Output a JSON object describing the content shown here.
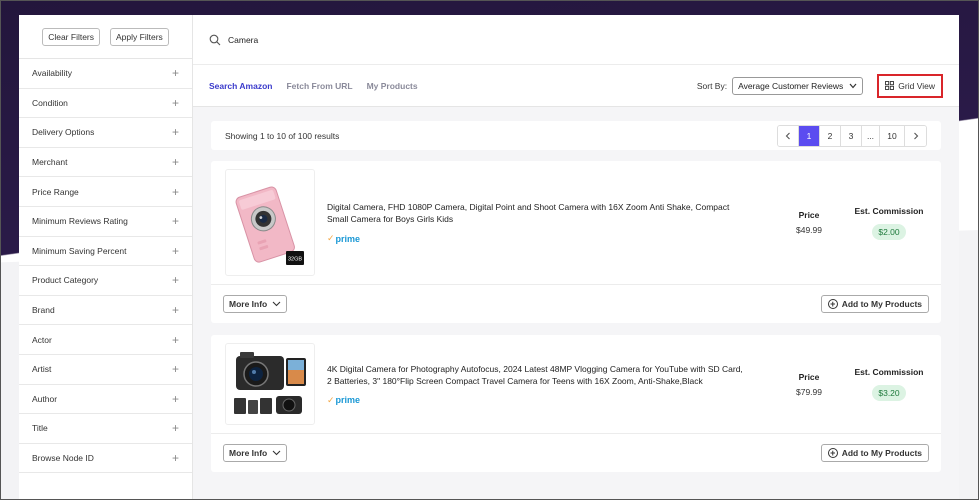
{
  "sidebar": {
    "clear_filters": "Clear Filters",
    "apply_filters": "Apply Filters",
    "filters": [
      {
        "label": "Availability"
      },
      {
        "label": "Condition"
      },
      {
        "label": "Delivery Options"
      },
      {
        "label": "Merchant"
      },
      {
        "label": "Price Range"
      },
      {
        "label": "Minimum Reviews Rating"
      },
      {
        "label": "Minimum Saving Percent"
      },
      {
        "label": "Product Category"
      },
      {
        "label": "Brand"
      },
      {
        "label": "Actor"
      },
      {
        "label": "Artist"
      },
      {
        "label": "Author"
      },
      {
        "label": "Title"
      },
      {
        "label": "Browse Node ID"
      }
    ]
  },
  "search": {
    "value": "Camera"
  },
  "tabs": [
    {
      "label": "Search Amazon"
    },
    {
      "label": "Fetch From URL"
    },
    {
      "label": "My Products"
    }
  ],
  "sort": {
    "label": "Sort By:",
    "selected": "Average Customer Reviews"
  },
  "grid_view": {
    "label": "Grid View"
  },
  "results": {
    "text": "Showing 1 to 10 of 100 results"
  },
  "pagination": {
    "pages": [
      "1",
      "2",
      "3",
      "...",
      "10"
    ],
    "current": "1"
  },
  "products": [
    {
      "title": "Digital Camera, FHD 1080P Camera, Digital Point and Shoot Camera with 16X Zoom Anti Shake, Compact Small Camera for Boys Girls Kids",
      "prime": "prime",
      "price_label": "Price",
      "price": "$49.99",
      "commission_label": "Est. Commission",
      "commission": "$2.00",
      "image_badge": "32GB",
      "more_info": "More Info",
      "add": "Add to My Products"
    },
    {
      "title": "4K Digital Camera for Photography Autofocus, 2024 Latest 48MP Vlogging Camera for YouTube with SD Card, 2 Batteries, 3\" 180°Flip Screen Compact Travel Camera for Teens with 16X Zoom, Anti-Shake,Black",
      "prime": "prime",
      "price_label": "Price",
      "price": "$79.99",
      "commission_label": "Est. Commission",
      "commission": "$3.20",
      "more_info": "More Info",
      "add": "Add to My Products"
    }
  ],
  "colors": {
    "accent": "#5b4cf0",
    "tab_active": "#3a3acb",
    "highlight_border": "#d9252a",
    "prime": "#1a98d5",
    "commission_bg": "#dcf3e3"
  }
}
